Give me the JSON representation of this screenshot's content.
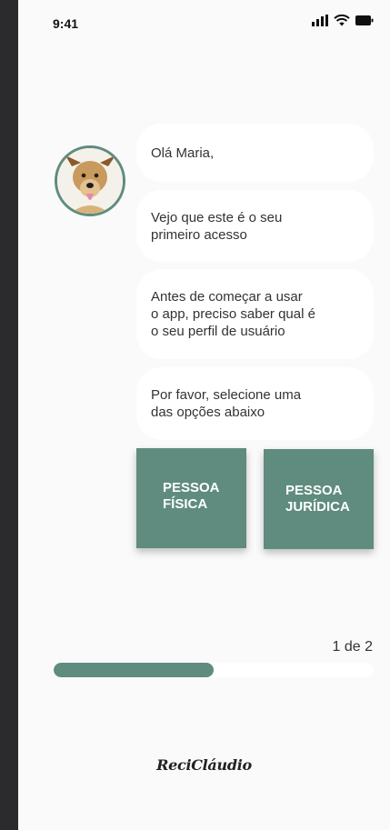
{
  "status_bar": {
    "time": "9:41",
    "icons": [
      "cellular-signal-icon",
      "wifi-icon",
      "battery-icon"
    ]
  },
  "chat": {
    "avatar": "dog-avatar",
    "messages": [
      "Olá Maria,",
      "Vejo que este é o seu\nprimeiro acesso",
      "Antes de começar a usar\no app, preciso saber qual é\no seu perfil de usuário",
      "Por favor, selecione uma\ndas opções abaixo"
    ]
  },
  "options": {
    "fisica_label": "PESSOA\nFÍSICA",
    "juridica_label": "PESSOA\nJURÍDICA"
  },
  "progress": {
    "label": "1 de 2",
    "value": 0.5
  },
  "brand": {
    "logo_text": "ReciCláudio"
  },
  "colors": {
    "accent": "#5f8c7e",
    "background": "#fafafa",
    "bubble": "#ffffff"
  }
}
